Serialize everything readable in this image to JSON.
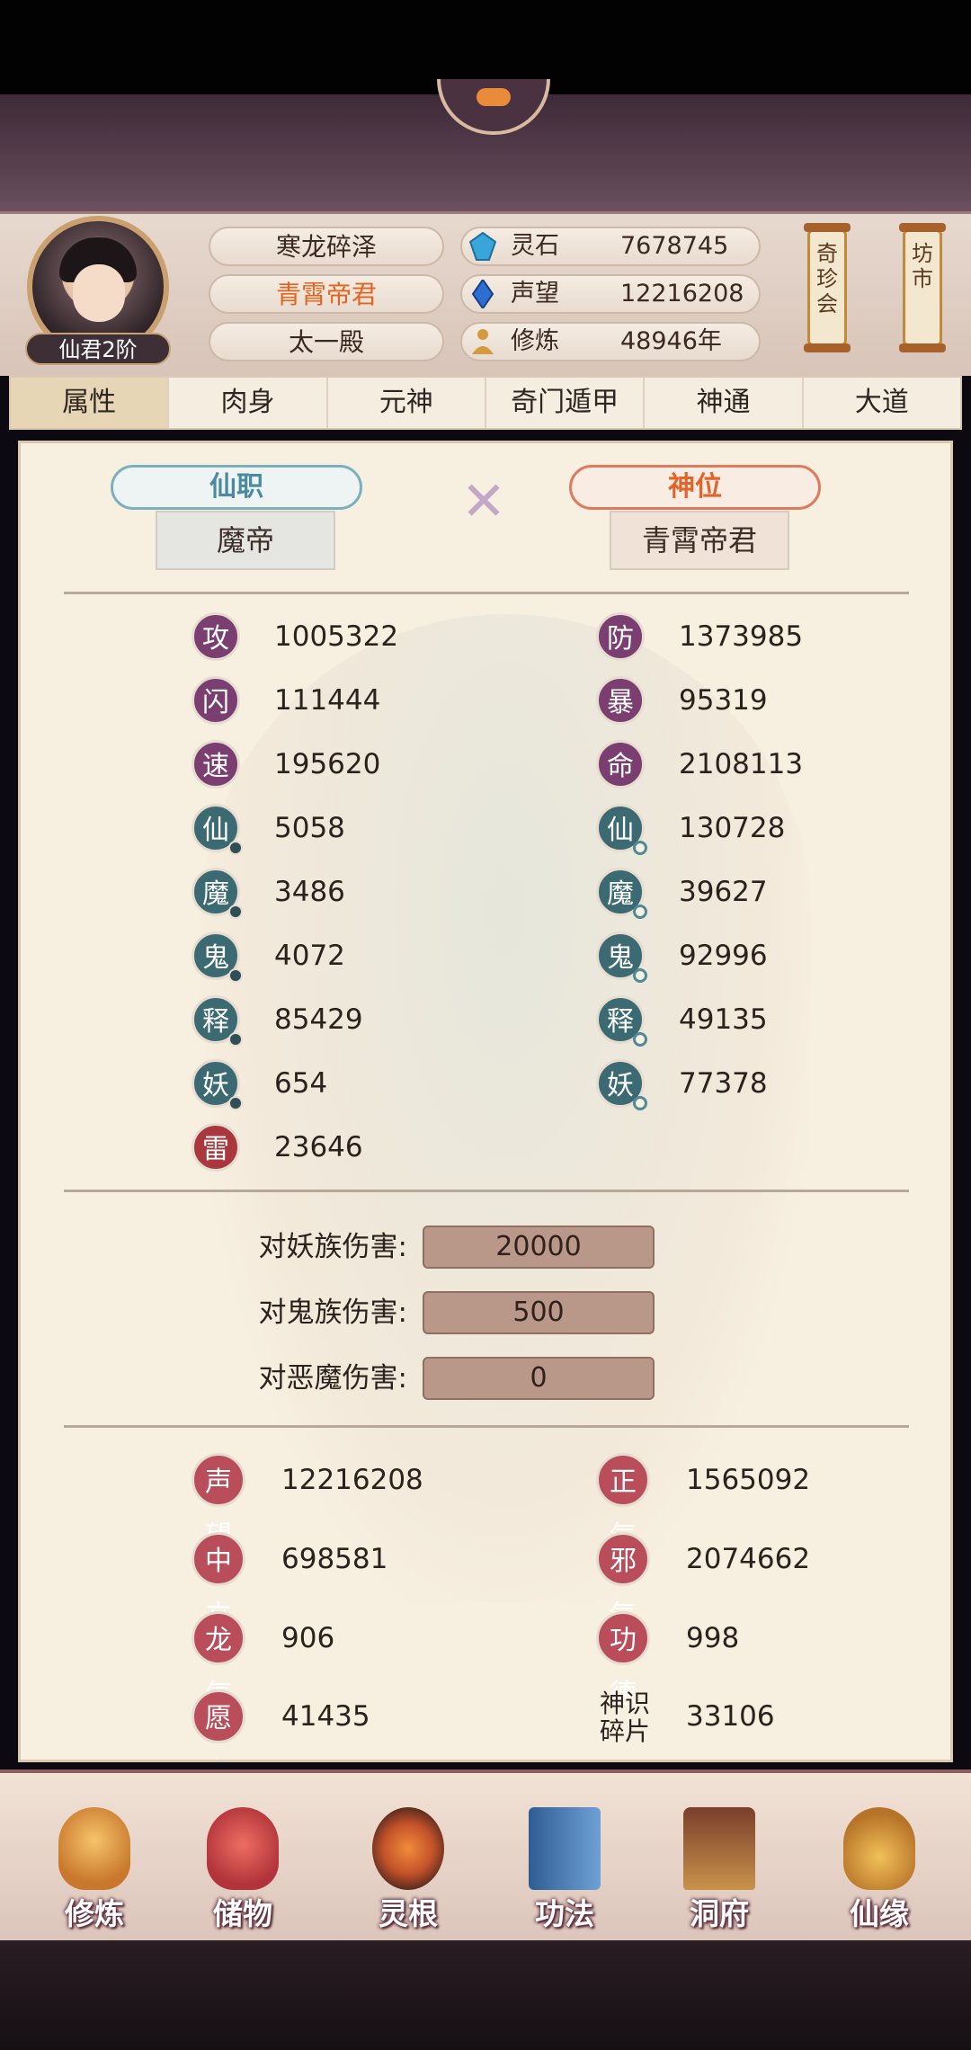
{
  "player": {
    "rank": "仙君2阶",
    "names": [
      "寒龙碎泽",
      "青霄帝君",
      "太一殿"
    ]
  },
  "resources": [
    {
      "label": "灵石",
      "value": "7678745",
      "icon": "spirit-stone-icon",
      "color": "#39a5d8"
    },
    {
      "label": "声望",
      "value": "12216208",
      "icon": "prestige-crystal-icon",
      "color": "#2d6fd1"
    },
    {
      "label": "修炼",
      "value": "48946年",
      "icon": "meditation-icon",
      "color": "#d59a3d"
    }
  ],
  "side_buttons": [
    "奇珍会",
    "坊市"
  ],
  "tabs": [
    "属性",
    "肉身",
    "元神",
    "奇门遁甲",
    "神通",
    "大道"
  ],
  "titles": {
    "left_banner": "仙职",
    "left_value": "魔帝",
    "right_banner": "神位",
    "right_value": "青霄帝君"
  },
  "stats_left": [
    {
      "badge": "攻",
      "value": "1005322"
    },
    {
      "badge": "闪",
      "value": "111444"
    },
    {
      "badge": "速",
      "value": "195620"
    },
    {
      "badge": "仙",
      "value": "5058"
    },
    {
      "badge": "魔",
      "value": "3486"
    },
    {
      "badge": "鬼",
      "value": "4072"
    },
    {
      "badge": "释",
      "value": "85429"
    },
    {
      "badge": "妖",
      "value": "654"
    },
    {
      "badge": "雷",
      "value": "23646"
    }
  ],
  "stats_right": [
    {
      "badge": "防",
      "value": "1373985"
    },
    {
      "badge": "暴",
      "value": "95319"
    },
    {
      "badge": "命",
      "value": "2108113"
    },
    {
      "badge": "仙",
      "value": "130728"
    },
    {
      "badge": "魔",
      "value": "39627"
    },
    {
      "badge": "鬼",
      "value": "92996"
    },
    {
      "badge": "释",
      "value": "49135"
    },
    {
      "badge": "妖",
      "value": "77378"
    }
  ],
  "damage": [
    {
      "label": "对妖族伤害:",
      "value": "20000"
    },
    {
      "label": "对鬼族伤害:",
      "value": "500"
    },
    {
      "label": "对恶魔伤害:",
      "value": "0"
    }
  ],
  "reputation_left": [
    {
      "badge": "声望",
      "value": "12216208"
    },
    {
      "badge": "中立",
      "value": "698581"
    },
    {
      "badge": "龙气",
      "value": "906"
    },
    {
      "badge": "愿力",
      "value": "41435"
    }
  ],
  "reputation_right": [
    {
      "badge": "正气",
      "value": "1565092"
    },
    {
      "badge": "邪气",
      "value": "2074662"
    },
    {
      "badge": "功德",
      "value": "998"
    },
    {
      "badge": "神识碎片",
      "value": "33106"
    }
  ],
  "nav": [
    {
      "label": "修炼",
      "icon": "cultivation-icon",
      "color": "#e0a24a"
    },
    {
      "label": "储物",
      "icon": "storage-bag-icon",
      "color": "#d9504c"
    },
    {
      "label": "灵根",
      "icon": "spirit-root-icon",
      "color": "#c0632e"
    },
    {
      "label": "功法",
      "icon": "technique-book-icon",
      "color": "#4f7fb8"
    },
    {
      "label": "洞府",
      "icon": "cave-dwelling-icon",
      "color": "#b8873f"
    },
    {
      "label": "仙缘",
      "icon": "fortune-gourd-icon",
      "color": "#d89a3a"
    }
  ]
}
